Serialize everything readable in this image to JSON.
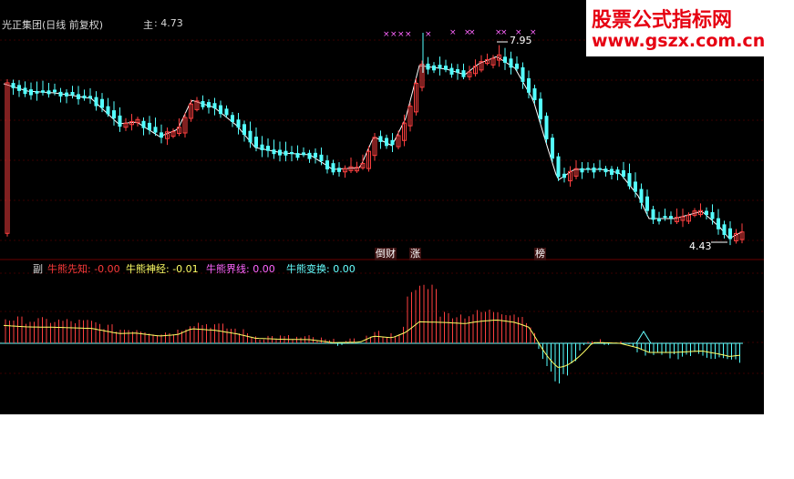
{
  "header": {
    "title": "光正集团(日线 前复权)",
    "main_label": "主",
    "main_value": ": 4.73"
  },
  "sub_header": {
    "label": "副",
    "indicators": [
      {
        "name": "牛熊先知",
        "value": "-0.00",
        "color": "#ff3b3b"
      },
      {
        "name": "牛熊神经",
        "value": "-0.01",
        "color": "#ffff66"
      },
      {
        "name": "牛熊界线",
        "value": "0.00",
        "color": "#ff66ff"
      },
      {
        "name": "牛熊变换",
        "value": "0.00",
        "color": "#66ffff"
      }
    ]
  },
  "annotations": {
    "high_price": "7.95",
    "low_price": "4.43",
    "signals": [
      "倒财",
      "涨",
      "榜"
    ]
  },
  "watermark": {
    "line1": "股票公式指标网",
    "line2": "www.gszx.com.cn"
  },
  "colors": {
    "background": "#000000",
    "up_candle": "#ff4040",
    "down_candle": "#54ffff",
    "ma_line": "#ffffff",
    "grid": "#3a0000",
    "osc_line": "#ffff66",
    "marker": "#ff66ff"
  },
  "chart_data": {
    "type": "candlestick",
    "price_high": 7.95,
    "price_low": 4.43,
    "last_close": 4.73,
    "oscillator_value": -0.0
  }
}
